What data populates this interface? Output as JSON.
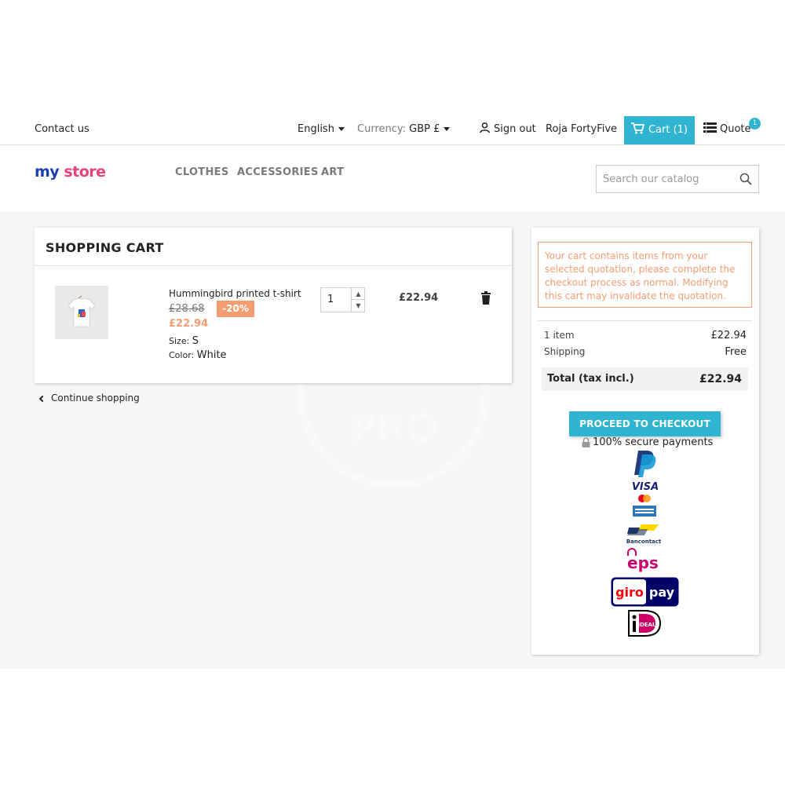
{
  "topnav": {
    "contact": "Contact us",
    "language": "English",
    "currency_label": "Currency:",
    "currency_value": "GBP £",
    "signout": "Sign out",
    "username": "Roja FortyFive",
    "cart": "Cart (1)",
    "quote": "Quote",
    "quote_count": "1"
  },
  "header": {
    "logo": {
      "part1": "my",
      "part2": "store"
    },
    "menu": [
      "CLOTHES",
      "ACCESSORIES",
      "ART"
    ],
    "search_placeholder": "Search our catalog"
  },
  "cart": {
    "title": "SHOPPING CART",
    "item": {
      "name": "Hummingbird printed t-shirt",
      "old_price": "£28.68",
      "discount": "-20%",
      "price": "£22.94",
      "size_label": "Size:",
      "size": "S",
      "color_label": "Color:",
      "color": "White",
      "quantity": "1",
      "total": "£22.94"
    },
    "continue": "Continue shopping"
  },
  "watermark": "PRO",
  "summary": {
    "notice": "Your cart contains items from your selected quotation, please complete the checkout process as normal. Modifying this cart may invalidate the quotation.",
    "items_label": "1 item",
    "items_value": "£22.94",
    "shipping_label": "Shipping",
    "shipping_value": "Free",
    "total_label": "Total (tax incl.)",
    "total_value": "£22.94",
    "checkout": "PROCEED TO CHECKOUT",
    "secure": "100% secure payments",
    "payments": {
      "visa": "VISA",
      "bancontact": "Bancontact",
      "eps": "eps",
      "giro": "giro",
      "pay": "pay",
      "ideal": "iDEAL"
    }
  },
  "colors": {
    "accent": "#2fb5d2",
    "discount": "#f39d72",
    "text": "#232323",
    "muted": "#7a7a7a"
  }
}
